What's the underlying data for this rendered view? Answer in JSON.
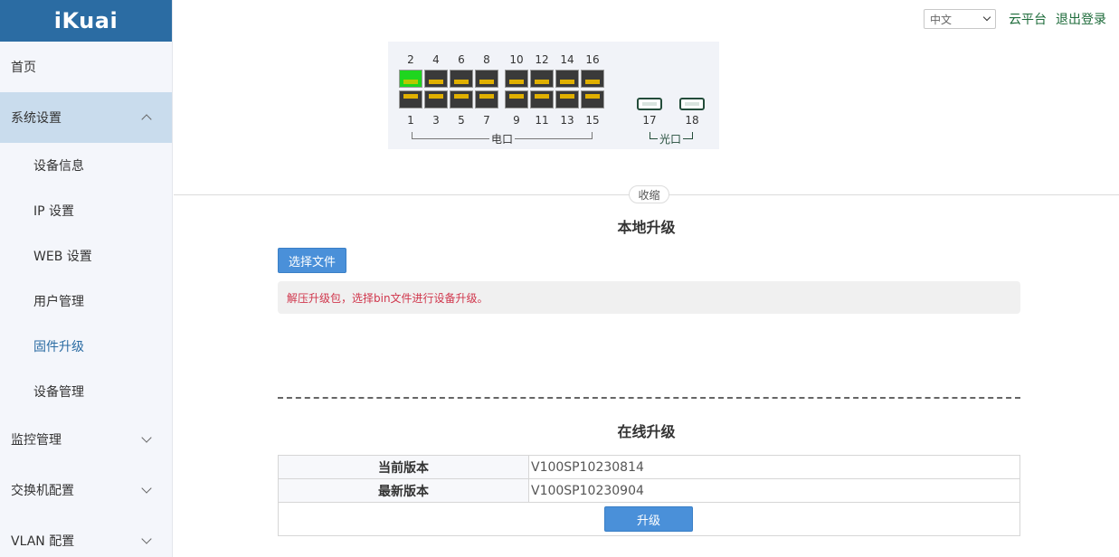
{
  "brand": {
    "logo": "iKuai",
    "header_color": "#2b6ca3"
  },
  "sidebar": {
    "items": [
      {
        "label": "首页"
      },
      {
        "label": "系统设置",
        "expanded": true,
        "icon": "chevron-up-icon",
        "children": [
          {
            "label": "设备信息"
          },
          {
            "label": "IP 设置"
          },
          {
            "label": "WEB 设置"
          },
          {
            "label": "用户管理"
          },
          {
            "label": "固件升级",
            "active": true
          },
          {
            "label": "设备管理"
          }
        ]
      },
      {
        "label": "监控管理",
        "icon": "chevron-down-icon"
      },
      {
        "label": "交换机配置",
        "icon": "chevron-down-icon"
      },
      {
        "label": "VLAN 配置",
        "icon": "chevron-down-icon"
      }
    ]
  },
  "topbar": {
    "language": "中文",
    "cloud_label": "云平台",
    "logout_label": "退出登录"
  },
  "switch": {
    "top_ports": [
      "2",
      "4",
      "6",
      "8",
      "10",
      "12",
      "14",
      "16"
    ],
    "bottom_ports": [
      "1",
      "3",
      "5",
      "7",
      "9",
      "11",
      "13",
      "15"
    ],
    "sfp_ports": [
      "17",
      "18"
    ],
    "active_port": "2",
    "electric_label": "电口",
    "optical_label": "光口",
    "active_color": "#1fd51f"
  },
  "collapse_label": "收缩",
  "local_upgrade": {
    "title": "本地升级",
    "choose_file_label": "选择文件",
    "hint": "解压升级包，选择bin文件进行设备升级。"
  },
  "online_upgrade": {
    "title": "在线升级",
    "rows": [
      {
        "label": "当前版本",
        "value": "V100SP10230814"
      },
      {
        "label": "最新版本",
        "value": "V100SP10230904"
      }
    ],
    "upgrade_label": "升级"
  }
}
